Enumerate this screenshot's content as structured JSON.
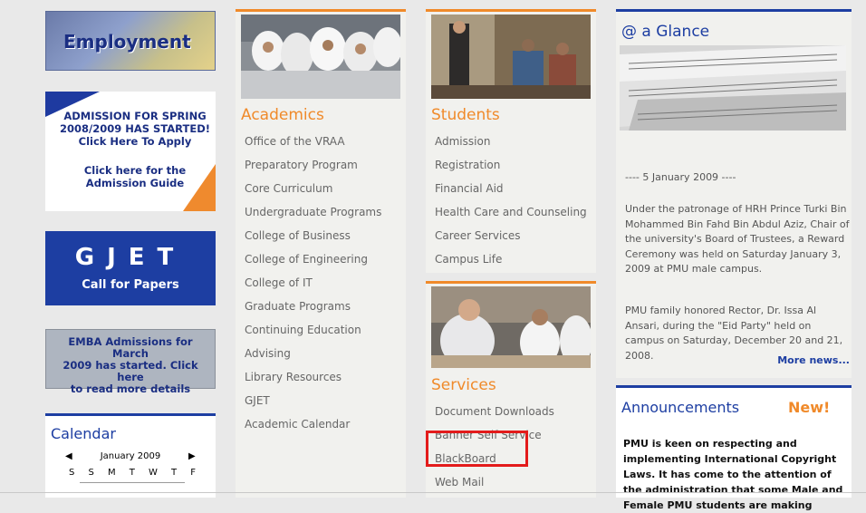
{
  "left": {
    "employment": "Employment",
    "admission": {
      "lines": [
        "ADMISSION FOR SPRING",
        "2008/2009 HAS STARTED!",
        "Click Here To Apply"
      ],
      "guide_lines": [
        "Click here for the",
        "Admission Guide"
      ]
    },
    "gjet": {
      "title": "GJET",
      "subtitle": "Call for Papers"
    },
    "emba": {
      "lines": [
        "EMBA Admissions for March",
        "2009 has started. Click here",
        "to read more details"
      ]
    },
    "calendar": {
      "title": "Calendar",
      "month": "January 2009",
      "prev": "◀",
      "next": "▶",
      "days": [
        "S",
        "S",
        "M",
        "T",
        "W",
        "T",
        "F"
      ]
    }
  },
  "academics": {
    "title": "Academics",
    "items": [
      "Office of the VRAA",
      "Preparatory Program",
      "Core Curriculum",
      "Undergraduate Programs",
      "College of Business",
      "College of Engineering",
      "College of IT",
      "Graduate Programs",
      "Continuing Education",
      "Advising",
      "Library Resources",
      "GJET",
      "Academic Calendar"
    ]
  },
  "students": {
    "title": "Students",
    "items": [
      "Admission",
      "Registration",
      "Financial Aid",
      "Health Care and Counseling",
      "Career Services",
      "Campus Life"
    ]
  },
  "services": {
    "title": "Services",
    "items": [
      "Document Downloads",
      "Banner Self Service",
      "BlackBoard",
      "Web Mail"
    ]
  },
  "glance": {
    "title": "@ a Glance",
    "date": "---- 5 January 2009 ----",
    "p1": "Under the patronage of HRH Prince Turki Bin Mohammed Bin Fahd Bin Abdul Aziz, Chair of the university's Board of Trustees, a Reward Ceremony was held on Saturday January 3, 2009 at PMU male campus.",
    "p2": "PMU family honored Rector, Dr. Issa Al Ansari, during the \"Eid Party\" held on campus on Saturday, December 20 and 21, 2008.",
    "more": "More news..."
  },
  "announcements": {
    "title": "Announcements",
    "badge": "New!",
    "body": "PMU is keen on respecting and implementing International Copyright Laws. It has come to the attention of the administration that some Male and Female PMU students are making"
  }
}
